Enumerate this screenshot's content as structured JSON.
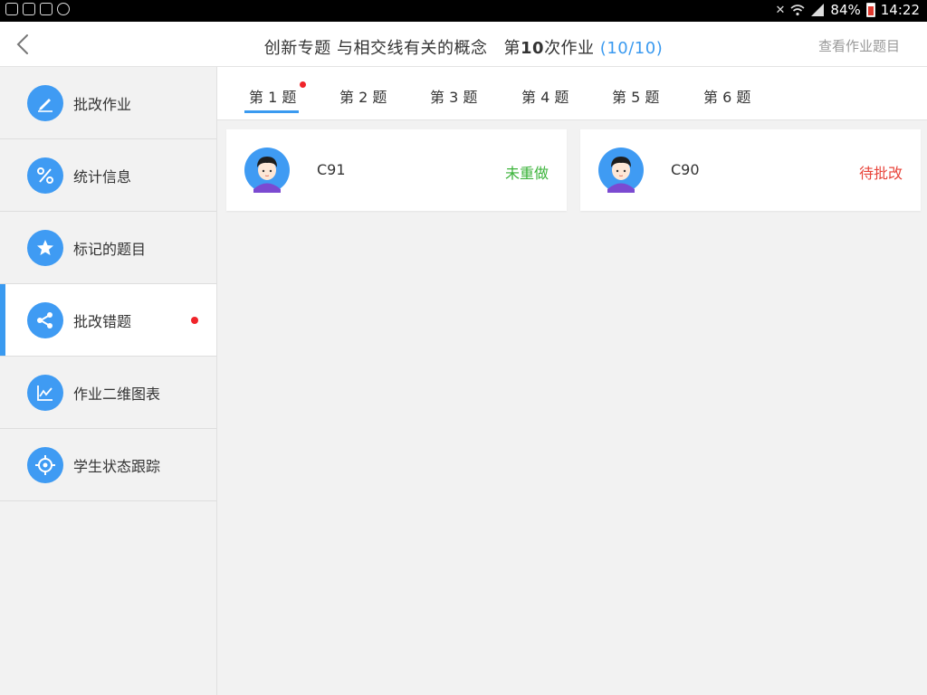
{
  "status_bar": {
    "battery": "84%",
    "time": "14:22"
  },
  "header": {
    "title_main": "创新专题 与相交线有关的概念",
    "title_prefix": "第",
    "title_number": "10",
    "title_suffix": "次作业",
    "title_count": "(10/10)",
    "view_link": "查看作业题目",
    "accent_color": "#3a9af0"
  },
  "sidebar": {
    "items": [
      {
        "label": "批改作业",
        "icon": "pencil-icon"
      },
      {
        "label": "统计信息",
        "icon": "percent-icon"
      },
      {
        "label": "标记的题目",
        "icon": "star-icon"
      },
      {
        "label": "批改错题",
        "icon": "share-icon",
        "active": true,
        "badge": "red-dot"
      },
      {
        "label": "作业二维图表",
        "icon": "line-chart-icon"
      },
      {
        "label": "学生状态跟踪",
        "icon": "target-icon"
      }
    ]
  },
  "tabs": [
    {
      "label": "第 1 题",
      "active": true,
      "badge": "red-dot"
    },
    {
      "label": "第 2 题"
    },
    {
      "label": "第 3 题"
    },
    {
      "label": "第 4 题"
    },
    {
      "label": "第 5 题"
    },
    {
      "label": "第 6 题"
    }
  ],
  "cards": [
    {
      "name": "C91",
      "status": "未重做",
      "status_color": "#3bb33a",
      "avatar": "student-avatar"
    },
    {
      "name": "C90",
      "status": "待批改",
      "status_color": "#e8443a",
      "avatar": "student-avatar"
    }
  ]
}
